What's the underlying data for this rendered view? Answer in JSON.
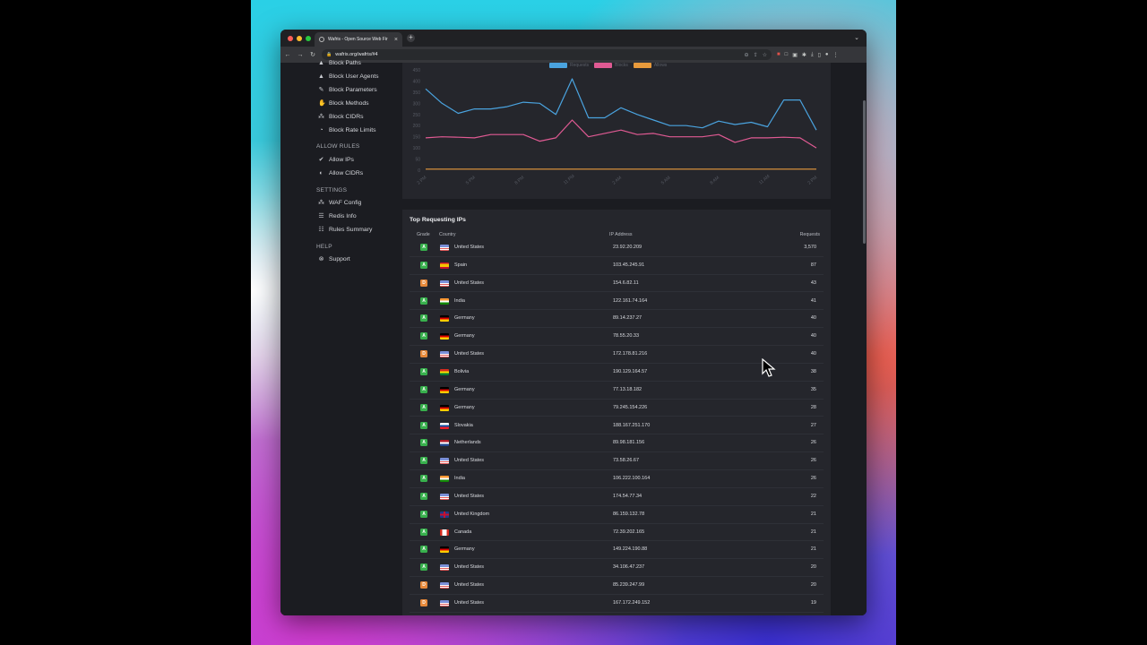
{
  "browser": {
    "tab_title": "Wafris - Open Source Web Fir",
    "url": "wafris.org/wafris/#4"
  },
  "sidebar": {
    "items_top": [
      {
        "label": "Block Paths",
        "icon": "block-path-icon",
        "glyph": "▲"
      },
      {
        "label": "Block User Agents",
        "icon": "user-agent-icon",
        "glyph": "▲"
      },
      {
        "label": "Block Parameters",
        "icon": "wrench-icon",
        "glyph": "✎"
      },
      {
        "label": "Block Methods",
        "icon": "hand-icon",
        "glyph": "✋"
      },
      {
        "label": "Block CIDRs",
        "icon": "network-icon",
        "glyph": "⁂"
      },
      {
        "label": "Block Rate Limits",
        "icon": "gauge-icon",
        "glyph": "◔"
      }
    ],
    "allow_heading": "ALLOW RULES",
    "allow_items": [
      {
        "label": "Allow IPs",
        "icon": "check-circle-icon",
        "glyph": "✔"
      },
      {
        "label": "Allow CIDRs",
        "icon": "shield-icon",
        "glyph": "◐"
      }
    ],
    "settings_heading": "SETTINGS",
    "settings_items": [
      {
        "label": "WAF Config",
        "icon": "config-icon",
        "glyph": "⁂"
      },
      {
        "label": "Redis Info",
        "icon": "database-icon",
        "glyph": "☰"
      },
      {
        "label": "Rules Summary",
        "icon": "list-icon",
        "glyph": "☷"
      }
    ],
    "help_heading": "HELP",
    "help_items": [
      {
        "label": "Support",
        "icon": "lifebuoy-icon",
        "glyph": "⊗"
      }
    ]
  },
  "chart_data": {
    "type": "line",
    "legend": [
      "Requests",
      "Blocks",
      "Allows"
    ],
    "colors": {
      "Requests": "#4aa3df",
      "Blocks": "#e05a93",
      "Allows": "#e89a3c"
    },
    "y_ticks": [
      "450",
      "400",
      "350",
      "300",
      "250",
      "200",
      "150",
      "100",
      "50",
      "0"
    ],
    "x_ticks": [
      "2 PM",
      "5 PM",
      "8 PM",
      "11 PM",
      "2 AM",
      "5 AM",
      "8 AM",
      "11 AM",
      "2 PM"
    ],
    "ylim": [
      0,
      450
    ],
    "series": [
      {
        "name": "Requests",
        "values": [
          365,
          300,
          255,
          275,
          275,
          285,
          305,
          300,
          250,
          410,
          235,
          235,
          280,
          250,
          225,
          200,
          200,
          190,
          220,
          205,
          215,
          195,
          315,
          315,
          180
        ]
      },
      {
        "name": "Blocks",
        "values": [
          145,
          150,
          148,
          145,
          160,
          160,
          160,
          130,
          145,
          225,
          150,
          165,
          180,
          160,
          165,
          150,
          150,
          150,
          160,
          125,
          145,
          145,
          148,
          145,
          100
        ]
      },
      {
        "name": "Allows",
        "values": [
          5,
          5,
          5,
          5,
          5,
          5,
          5,
          5,
          5,
          5,
          5,
          5,
          5,
          5,
          5,
          5,
          5,
          5,
          5,
          5,
          5,
          5,
          5,
          5,
          5
        ]
      }
    ]
  },
  "top_ips": {
    "title": "Top Requesting IPs",
    "headers": {
      "grade": "Grade",
      "country": "Country",
      "ip": "IP Address",
      "requests": "Requests"
    },
    "grade_colors": {
      "A": "#38b04d",
      "D": "#e6893a"
    },
    "rows": [
      {
        "grade": "A",
        "flag": "us",
        "country": "United States",
        "ip": "23.92.20.209",
        "requests": "3,570"
      },
      {
        "grade": "A",
        "flag": "es",
        "country": "Spain",
        "ip": "103.45.245.91",
        "requests": "87"
      },
      {
        "grade": "D",
        "flag": "us",
        "country": "United States",
        "ip": "154.6.82.11",
        "requests": "43"
      },
      {
        "grade": "A",
        "flag": "in",
        "country": "India",
        "ip": "122.161.74.164",
        "requests": "41"
      },
      {
        "grade": "A",
        "flag": "de",
        "country": "Germany",
        "ip": "89.14.237.27",
        "requests": "40"
      },
      {
        "grade": "A",
        "flag": "de",
        "country": "Germany",
        "ip": "78.55.20.33",
        "requests": "40"
      },
      {
        "grade": "D",
        "flag": "us",
        "country": "United States",
        "ip": "172.178.81.216",
        "requests": "40"
      },
      {
        "grade": "A",
        "flag": "bo",
        "country": "Bolivia",
        "ip": "190.129.164.57",
        "requests": "38"
      },
      {
        "grade": "A",
        "flag": "de",
        "country": "Germany",
        "ip": "77.13.18.182",
        "requests": "35"
      },
      {
        "grade": "A",
        "flag": "de",
        "country": "Germany",
        "ip": "79.245.154.226",
        "requests": "28"
      },
      {
        "grade": "A",
        "flag": "sk",
        "country": "Slovakia",
        "ip": "188.167.251.170",
        "requests": "27"
      },
      {
        "grade": "A",
        "flag": "nl",
        "country": "Netherlands",
        "ip": "89.98.181.156",
        "requests": "26"
      },
      {
        "grade": "A",
        "flag": "us",
        "country": "United States",
        "ip": "73.58.26.67",
        "requests": "26"
      },
      {
        "grade": "A",
        "flag": "in",
        "country": "India",
        "ip": "106.222.100.164",
        "requests": "26"
      },
      {
        "grade": "A",
        "flag": "us",
        "country": "United States",
        "ip": "174.54.77.34",
        "requests": "22"
      },
      {
        "grade": "A",
        "flag": "gb",
        "country": "United Kingdom",
        "ip": "86.159.132.78",
        "requests": "21"
      },
      {
        "grade": "A",
        "flag": "ca",
        "country": "Canada",
        "ip": "72.39.202.165",
        "requests": "21"
      },
      {
        "grade": "A",
        "flag": "de",
        "country": "Germany",
        "ip": "149.224.190.88",
        "requests": "21"
      },
      {
        "grade": "A",
        "flag": "us",
        "country": "United States",
        "ip": "34.106.47.237",
        "requests": "20"
      },
      {
        "grade": "D",
        "flag": "us",
        "country": "United States",
        "ip": "85.239.247.99",
        "requests": "20"
      },
      {
        "grade": "D",
        "flag": "us",
        "country": "United States",
        "ip": "167.172.249.152",
        "requests": "19"
      }
    ]
  }
}
